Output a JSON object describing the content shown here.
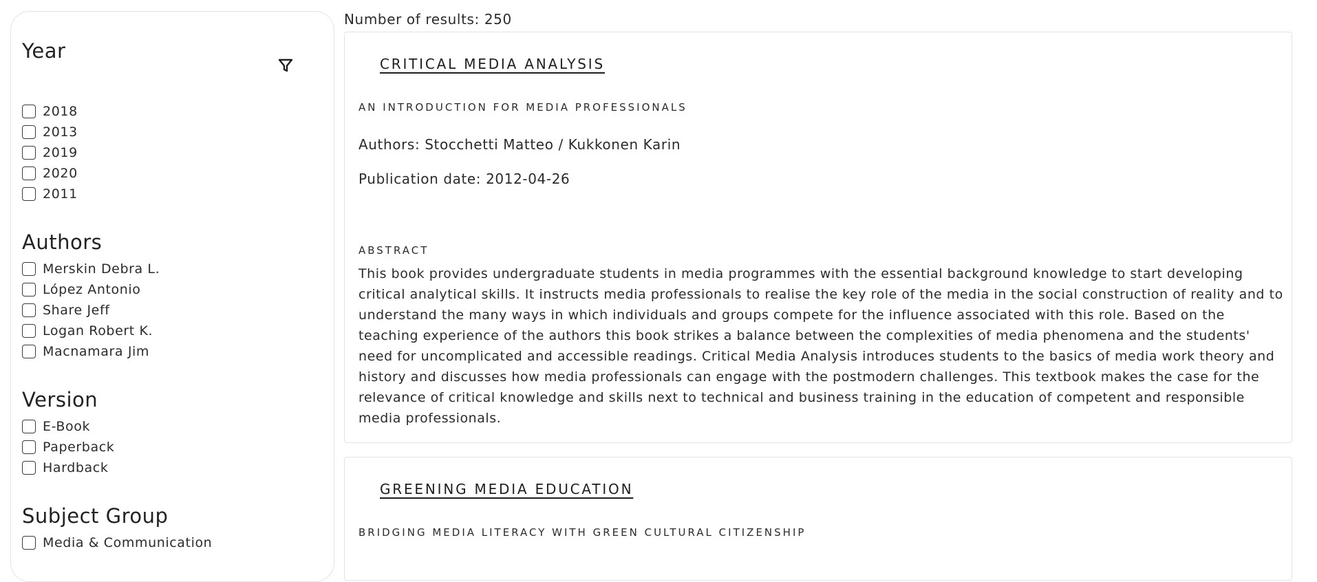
{
  "sidebar": {
    "year": {
      "title": "Year",
      "options": [
        "2018",
        "2013",
        "2019",
        "2020",
        "2011"
      ]
    },
    "authors": {
      "title": "Authors",
      "options": [
        "Merskin Debra L.",
        "López Antonio",
        "Share Jeff",
        "Logan Robert K.",
        "Macnamara Jim"
      ]
    },
    "version": {
      "title": "Version",
      "options": [
        "E-Book",
        "Paperback",
        "Hardback"
      ]
    },
    "subject_group": {
      "title": "Subject Group",
      "options": [
        "Media & Communication"
      ]
    },
    "filter_icon": "filter-icon"
  },
  "results": {
    "count_text": "Number of results: 250",
    "items": [
      {
        "title": "CRITICAL MEDIA ANALYSIS",
        "subtitle": "AN INTRODUCTION FOR MEDIA PROFESSIONALS",
        "authors": "Authors: Stocchetti Matteo / Kukkonen Karin",
        "publication_date": "Publication date: 2012-04-26",
        "abstract_label": "ABSTRACT",
        "abstract": "This book provides undergraduate students in media programmes with the essential background knowledge to start developing critical analytical skills. It instructs media professionals to realise the key role of the media in the social construction of reality and to understand the many ways in which individuals and groups compete for the influence associated with this role. Based on the teaching experience of the authors this book strikes a balance between the complexities of media phenomena and the students' need for uncomplicated and accessible readings. Critical Media Analysis introduces students to the basics of media work theory and history and discusses how media professionals can engage with the postmodern challenges. This textbook makes the case for the relevance of critical knowledge and skills next to technical and business training in the education of competent and responsible media professionals."
      },
      {
        "title": "GREENING MEDIA EDUCATION",
        "subtitle": "BRIDGING MEDIA LITERACY WITH GREEN CULTURAL CITIZENSHIP"
      }
    ]
  }
}
